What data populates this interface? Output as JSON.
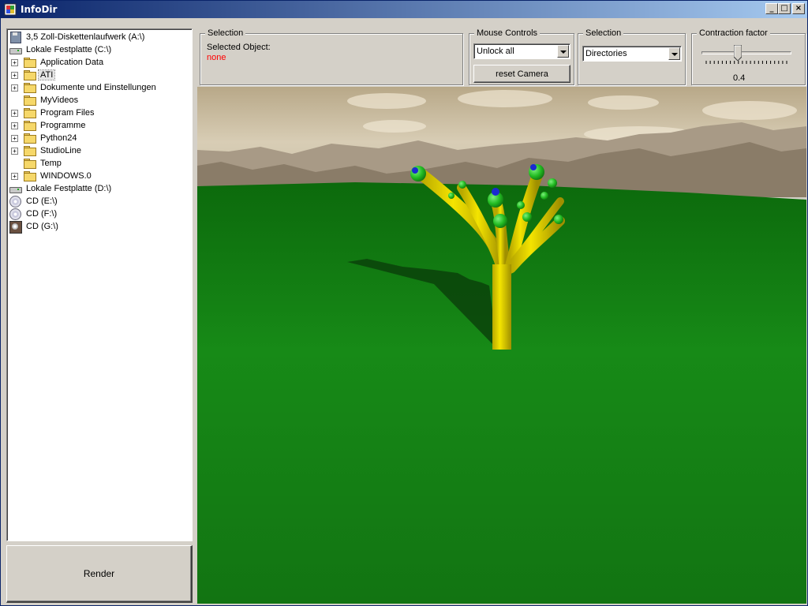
{
  "window": {
    "title": "InfoDir"
  },
  "tree": {
    "items": [
      {
        "label": "3,5 Zoll-Diskettenlaufwerk (A:\\)",
        "icon": "floppy-drive-icon",
        "level": 0,
        "expander": ""
      },
      {
        "label": "Lokale Festplatte (C:\\)",
        "icon": "hard-drive-icon",
        "level": 0,
        "expander": ""
      },
      {
        "label": "Application Data",
        "icon": "folder-icon",
        "level": 1,
        "expander": "+"
      },
      {
        "label": "ATI",
        "icon": "folder-icon",
        "level": 1,
        "expander": "+",
        "selected": true
      },
      {
        "label": "Dokumente und Einstellungen",
        "icon": "folder-icon",
        "level": 1,
        "expander": "+"
      },
      {
        "label": "MyVideos",
        "icon": "folder-icon",
        "level": 1,
        "expander": ""
      },
      {
        "label": "Program Files",
        "icon": "folder-icon",
        "level": 1,
        "expander": "+"
      },
      {
        "label": "Programme",
        "icon": "folder-icon",
        "level": 1,
        "expander": "+"
      },
      {
        "label": "Python24",
        "icon": "folder-icon",
        "level": 1,
        "expander": "+"
      },
      {
        "label": "StudioLine",
        "icon": "folder-icon",
        "level": 1,
        "expander": "+"
      },
      {
        "label": "Temp",
        "icon": "folder-icon",
        "level": 1,
        "expander": ""
      },
      {
        "label": "WINDOWS.0",
        "icon": "folder-icon",
        "level": 1,
        "expander": "+"
      },
      {
        "label": "Lokale Festplatte (D:\\)",
        "icon": "hard-drive-icon",
        "level": 0,
        "expander": ""
      },
      {
        "label": "CD (E:\\)",
        "icon": "cd-drive-icon",
        "level": 0,
        "expander": ""
      },
      {
        "label": "CD (F:\\)",
        "icon": "cd-drive-icon",
        "level": 0,
        "expander": ""
      },
      {
        "label": "CD (G:\\)",
        "icon": "dvd-drive-icon",
        "level": 0,
        "expander": ""
      }
    ]
  },
  "render_button": {
    "label": "Render"
  },
  "selection_info": {
    "legend": "Selection",
    "selected_label": "Selected Object:",
    "selected_value": "none",
    "value_color": "#ff0000"
  },
  "mouse_controls": {
    "legend": "Mouse Controls",
    "mode_value": "Unlock all",
    "reset_label": "reset Camera"
  },
  "selection_type": {
    "legend": "Selection",
    "value": "Directories"
  },
  "contraction": {
    "legend": "Contraction factor",
    "value": "0.4",
    "slider_fraction": 0.4
  },
  "scene": {
    "sky_color": "#c8b898",
    "ground_color": "#157a15",
    "trunk_color": "#e8d800",
    "node_color": "#33cc33",
    "node_accent": "#1a2ad0"
  }
}
